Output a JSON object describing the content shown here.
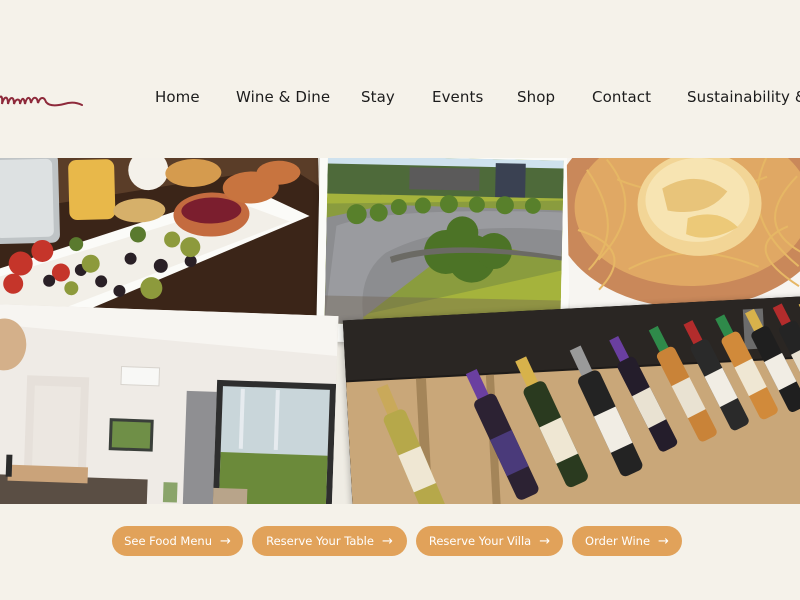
{
  "brand": {
    "logo_text": "ume",
    "logo_color": "#8e2a3b"
  },
  "nav": {
    "items": [
      {
        "label": "Home"
      },
      {
        "label": "Wine & Dine"
      },
      {
        "label": "Stay"
      },
      {
        "label": "Events"
      },
      {
        "label": "Shop"
      },
      {
        "label": "Contact"
      },
      {
        "label": "Sustainability &"
      }
    ]
  },
  "collage": {
    "photos": [
      {
        "subject": "antipasto-platter"
      },
      {
        "subject": "garden-driveway"
      },
      {
        "subject": "baked-brie-bowl"
      },
      {
        "subject": "villa-living-room"
      },
      {
        "subject": "wine-bottle-display"
      }
    ]
  },
  "cta": {
    "buttons": [
      {
        "label": "See Food Menu",
        "icon": "arrow-right-icon"
      },
      {
        "label": "Reserve Your Table",
        "icon": "arrow-right-icon"
      },
      {
        "label": "Reserve Your Villa",
        "icon": "arrow-right-icon"
      },
      {
        "label": "Order Wine",
        "icon": "arrow-right-icon"
      }
    ],
    "arrow_glyph": "→",
    "color": "#e1a25a"
  },
  "colors": {
    "background": "#f5f2ea",
    "text": "#1c1c1c"
  }
}
